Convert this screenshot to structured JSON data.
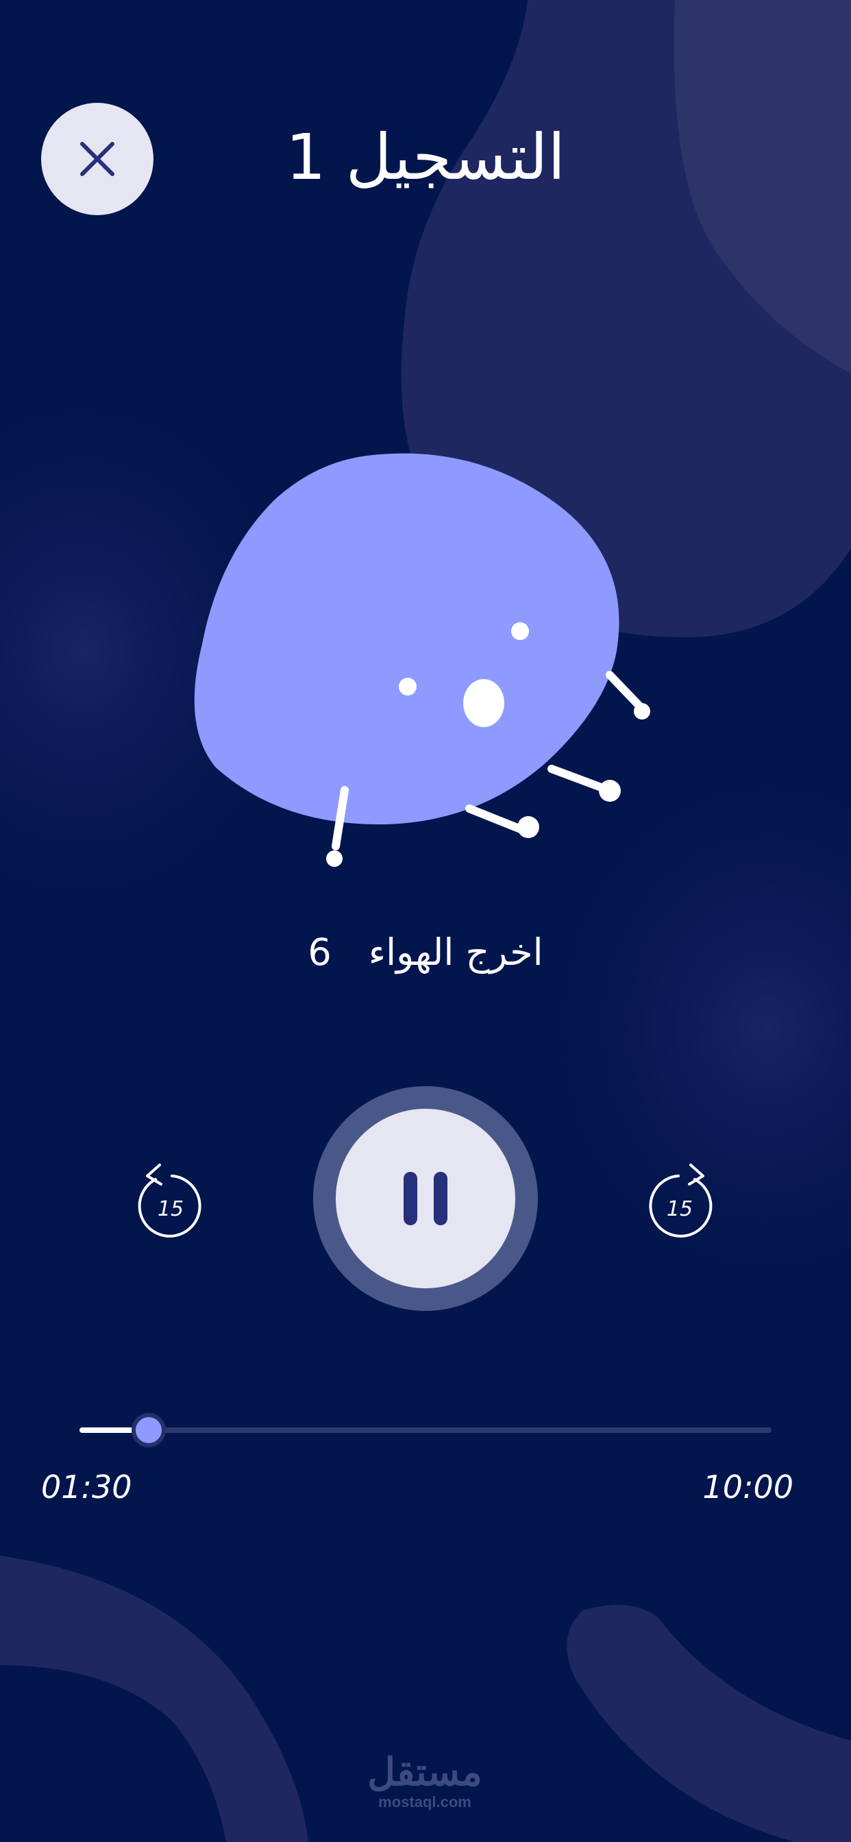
{
  "header": {
    "title": "التسجيل 1",
    "close_icon": "close-icon"
  },
  "exercise": {
    "label": "اخرج الهواء",
    "count": "6"
  },
  "controls": {
    "skip_back_amount": "15",
    "skip_forward_amount": "15",
    "play_state": "pause-icon"
  },
  "progress": {
    "elapsed": "01:30",
    "total": "10:00",
    "fraction": 0.1
  },
  "watermark": {
    "arabic": "مستقل",
    "domain": "mostaql.com"
  },
  "colors": {
    "background": "#03154d",
    "accent": "#8f9aff",
    "button": "#e6e6f2",
    "icon_dark": "#27307a"
  }
}
